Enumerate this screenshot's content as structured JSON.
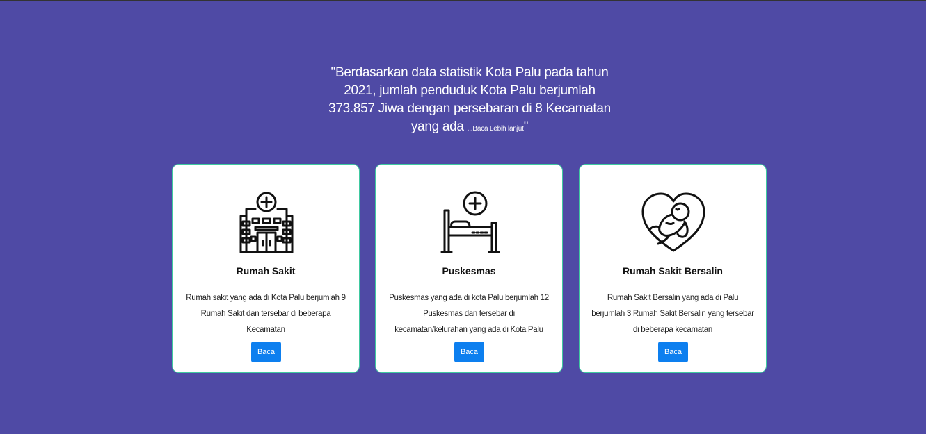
{
  "intro": {
    "text": "\"Berdasarkan data statistik Kota Palu pada tahun 2021, jumlah penduduk Kota Palu berjumlah 373.857 Jiwa dengan persebaran di 8 Kecamatan yang ada ",
    "more_link": "...Baca Lebih lanjut",
    "closing": "\""
  },
  "cards": [
    {
      "icon": "hospital-icon",
      "title": "Rumah Sakit",
      "description": "Rumah sakit yang ada di Kota Palu berjumlah 9 Rumah Sakit dan tersebar di beberapa Kecamatan",
      "button": "Baca"
    },
    {
      "icon": "hospital-bed-icon",
      "title": "Puskesmas",
      "description": "Puskesmas yang ada di kota Palu berjumlah 12 Puskesmas dan tersebar di kecamatan/kelurahan yang ada di Kota Palu",
      "button": "Baca"
    },
    {
      "icon": "baby-heart-icon",
      "title": "Rumah Sakit Bersalin",
      "description": "Rumah Sakit Bersalin yang ada di Palu berjumlah 3 Rumah Sakit Bersalin yang tersebar di beberapa kecamatan",
      "button": "Baca"
    }
  ],
  "colors": {
    "background": "#4f4aa5",
    "button": "#0d7fef",
    "card_border": "#3fc9a0"
  }
}
